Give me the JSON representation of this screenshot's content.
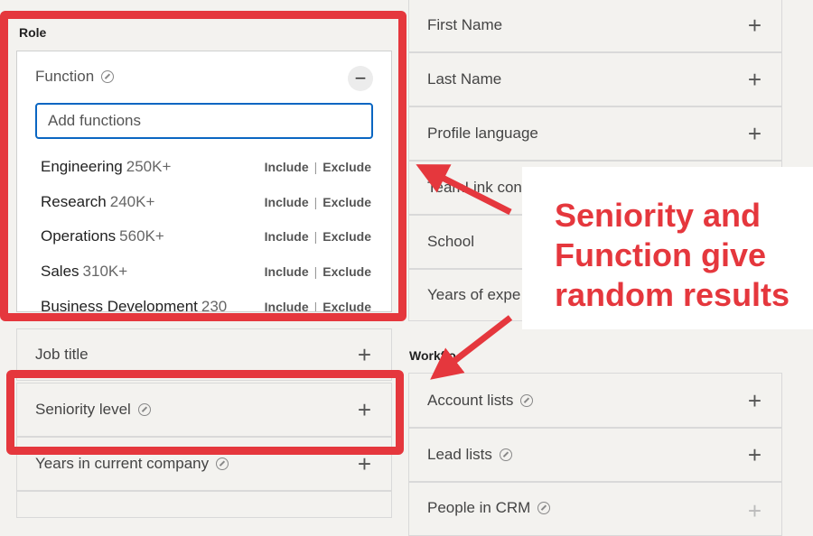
{
  "role_section": {
    "label": "Role"
  },
  "function_panel": {
    "title": "Function",
    "search_placeholder": "Add functions",
    "items": [
      {
        "name": "Engineering",
        "count": "250K+",
        "include": "Include",
        "exclude": "Exclude"
      },
      {
        "name": "Research",
        "count": "240K+",
        "include": "Include",
        "exclude": "Exclude"
      },
      {
        "name": "Operations",
        "count": "560K+",
        "include": "Include",
        "exclude": "Exclude"
      },
      {
        "name": "Sales",
        "count": "310K+",
        "include": "Include",
        "exclude": "Exclude"
      },
      {
        "name": "Business Development",
        "count": "230",
        "include": "Include",
        "exclude": "Exclude"
      }
    ]
  },
  "left_filters": {
    "job_title": "Job title",
    "seniority_level": "Seniority level",
    "years_current_company": "Years in current company"
  },
  "right_filters": {
    "first_name": "First Name",
    "last_name": "Last Name",
    "profile_language": "Profile language",
    "teamlink": "TeamLink con",
    "school": "School",
    "years_experience": "Years of expe"
  },
  "workflow_section": {
    "label": "Workflo",
    "account_lists": "Account lists",
    "lead_lists": "Lead lists",
    "people_in_crm": "People in CRM"
  },
  "annotation": {
    "text": "Seniority and Function give random results",
    "color": "#e5373d"
  },
  "colors": {
    "accent": "#0a66c2",
    "annotation": "#e5373d",
    "background": "#f3f2ef"
  }
}
